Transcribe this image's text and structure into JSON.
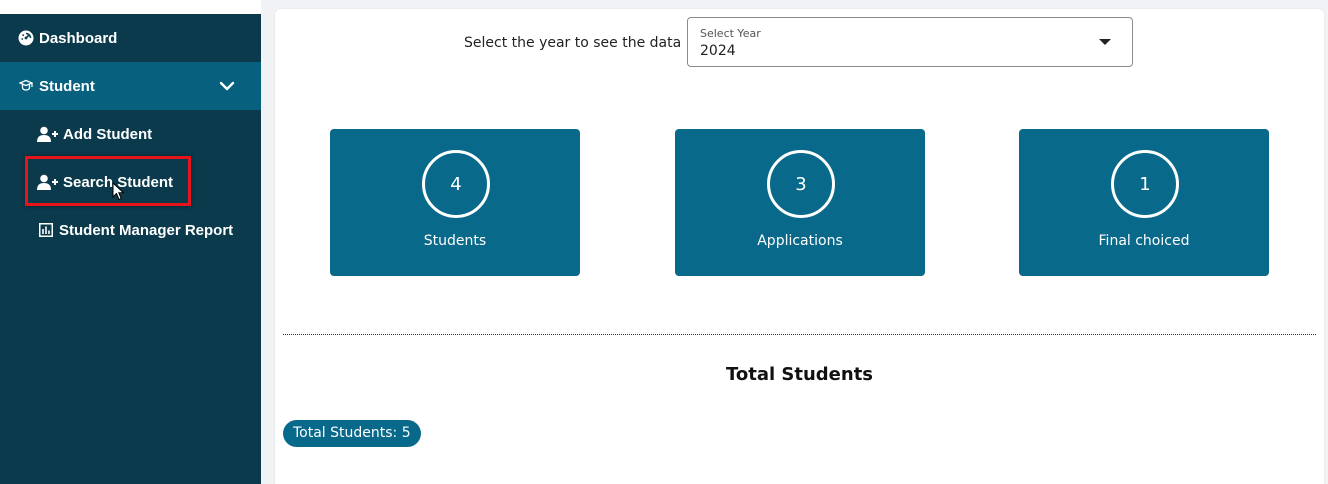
{
  "sidebar": {
    "items": [
      {
        "label": "Dashboard",
        "icon": "dashboard-icon"
      },
      {
        "label": "Student",
        "icon": "student-icon"
      },
      {
        "label": "Add Student",
        "icon": "add-user-icon"
      },
      {
        "label": "Search Student",
        "icon": "add-user-icon"
      },
      {
        "label": "Student Manager Report",
        "icon": "bar-chart-icon"
      }
    ]
  },
  "year_filter": {
    "prompt": "Select the year to see the data",
    "floating_label": "Select Year",
    "value": "2024"
  },
  "stats": [
    {
      "value": "4",
      "label": "Students"
    },
    {
      "value": "3",
      "label": "Applications"
    },
    {
      "value": "1",
      "label": "Final choiced"
    }
  ],
  "section": {
    "title": "Total Students",
    "badge": "Total Students: 5"
  },
  "colors": {
    "sidebar_bg": "#0b3a4c",
    "active_bg": "#08607f",
    "card_bg": "#08698a",
    "highlight": "#e8141c"
  }
}
